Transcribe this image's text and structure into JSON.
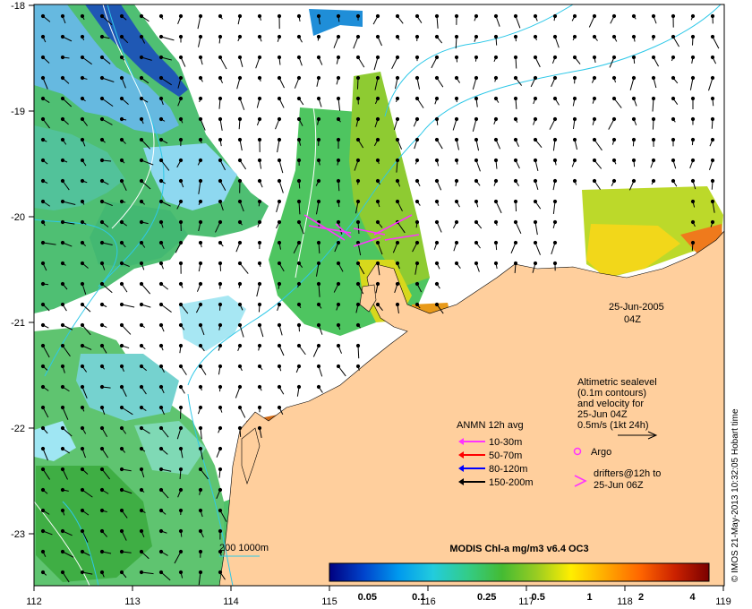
{
  "map": {
    "date_label": "25-Jun-2005",
    "time_label": "04Z",
    "x_ticks": [
      "112",
      "113",
      "114",
      "115",
      "116",
      "117",
      "118",
      "119"
    ],
    "y_ticks": [
      "-18",
      "-19",
      "-20",
      "-21",
      "-22",
      "-23"
    ],
    "lon_range": [
      112,
      119
    ],
    "lat_range": [
      -23.5,
      -18
    ],
    "colors": {
      "land": "#ffcf9d",
      "cloud": "#ffffff",
      "contour": "#2ec8e8",
      "drifter": "#ff33ff"
    }
  },
  "altimetry": {
    "line1": "Altimetric sealevel",
    "line2": "(0.1m contours)",
    "line3": "and velocity for",
    "line4": "25-Jun 04Z",
    "line5": "0.5m/s (1kt 24h)"
  },
  "anmn": {
    "title": "ANMN 12h avg",
    "items": [
      {
        "label": "10-30m",
        "color": "#ff33ff"
      },
      {
        "label": "50-70m",
        "color": "#ff0000"
      },
      {
        "label": "80-120m",
        "color": "#0000ff"
      },
      {
        "label": "150-200m",
        "color": "#000000"
      }
    ]
  },
  "argo": {
    "label": "Argo"
  },
  "drifters": {
    "line1": "drifters@12h to",
    "line2": "25-Jun 06Z"
  },
  "isobath": {
    "label": "200  1000m"
  },
  "colorbar": {
    "title": "MODIS Chl-a mg/m3 v6.4 OC3",
    "tick_labels": [
      "0.05",
      "0.1",
      "0.25",
      "0.5",
      "1",
      "2",
      "4"
    ],
    "tick_values": [
      0.05,
      0.1,
      0.25,
      0.5,
      1,
      2,
      4
    ],
    "range": [
      0.03,
      5
    ],
    "colors": [
      "#000080",
      "#0044cc",
      "#0099ee",
      "#22ccdd",
      "#33cc88",
      "#44bb33",
      "#99cc22",
      "#ffee00",
      "#ffaa00",
      "#ff6600",
      "#cc2200",
      "#7a0000"
    ]
  },
  "credit": "© IMOS 21-May-2013 10:32:05 Hobart time"
}
